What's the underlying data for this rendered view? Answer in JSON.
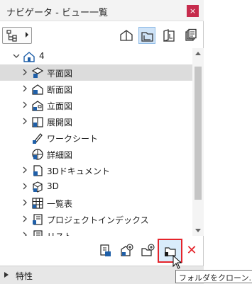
{
  "window": {
    "title": "ナビゲータ - ビュー一覧",
    "close_glyph": "×"
  },
  "toolbar": {
    "map_button_icon": "navigator-map-icon",
    "view_buttons": [
      {
        "icon": "project-map-icon",
        "selected": false
      },
      {
        "icon": "view-map-icon",
        "selected": true
      },
      {
        "icon": "layout-book-icon",
        "selected": false
      },
      {
        "icon": "publisher-sets-icon",
        "selected": false
      }
    ]
  },
  "tree": {
    "root": {
      "label": "4",
      "icon": "house-icon",
      "expanded": true
    },
    "items": [
      {
        "label": "平面図",
        "icon": "floor-plan-icon",
        "has_children": true,
        "selected": true
      },
      {
        "label": "断面図",
        "icon": "section-icon",
        "has_children": true,
        "selected": false
      },
      {
        "label": "立面図",
        "icon": "elevation-icon",
        "has_children": true,
        "selected": false
      },
      {
        "label": "展開図",
        "icon": "interior-elevation-icon",
        "has_children": true,
        "selected": false
      },
      {
        "label": "ワークシート",
        "icon": "worksheet-icon",
        "has_children": false,
        "selected": false
      },
      {
        "label": "詳細図",
        "icon": "detail-icon",
        "has_children": false,
        "selected": false
      },
      {
        "label": "3Dドキュメント",
        "icon": "3d-document-icon",
        "has_children": true,
        "selected": false
      },
      {
        "label": "3D",
        "icon": "3d-icon",
        "has_children": true,
        "selected": false
      },
      {
        "label": "一覧表",
        "icon": "schedule-icon",
        "has_children": true,
        "selected": false
      },
      {
        "label": "プロジェクトインデックス",
        "icon": "project-index-icon",
        "has_children": true,
        "selected": false
      },
      {
        "label": "リスト",
        "icon": "list-icon",
        "has_children": true,
        "selected": false
      }
    ]
  },
  "bottom_toolbar": {
    "buttons": [
      {
        "icon": "view-settings-icon"
      },
      {
        "icon": "new-view-icon"
      },
      {
        "icon": "new-folder-icon"
      },
      {
        "icon": "clone-folder-icon",
        "highlighted": true
      }
    ],
    "delete_glyph": "✕"
  },
  "footer": {
    "label": "特性"
  },
  "tooltip": {
    "text": "フォルダをクローン..."
  },
  "colors": {
    "accent_blue": "#1f5fa8",
    "close_red": "#c62b4c",
    "highlight_red": "#e5242b",
    "selection_gray": "#dcdcdc",
    "pressed_blue": "#d9ecfb"
  }
}
